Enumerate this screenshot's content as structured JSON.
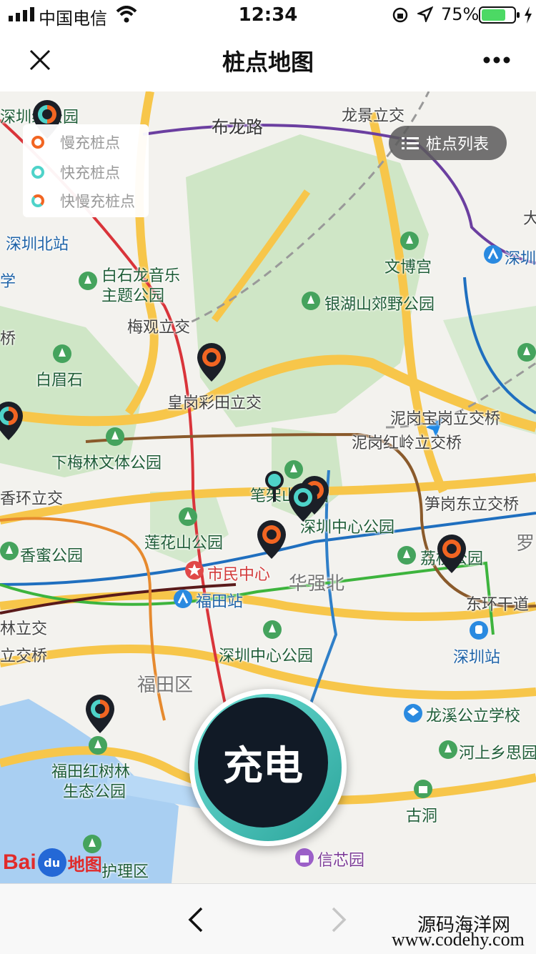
{
  "status_bar": {
    "carrier": "中国电信",
    "time": "12:34",
    "battery_percent": "75%",
    "battery_level": 0.75,
    "icons": [
      "signal-icon",
      "wifi-icon",
      "rotation-lock-icon",
      "location-arrow-icon",
      "battery-icon",
      "charging-bolt-icon"
    ]
  },
  "navbar": {
    "title": "桩点地图",
    "close_icon": "close-icon",
    "more_icon": "more-dots-icon"
  },
  "legend": {
    "items": [
      {
        "label": "慢充桩点",
        "color": "#f26522"
      },
      {
        "label": "快充桩点",
        "color": "#4ed3c9"
      },
      {
        "label": "快慢充桩点",
        "color": "mixed"
      }
    ]
  },
  "list_button": {
    "label": "桩点列表",
    "icon": "list-icon"
  },
  "map": {
    "labels": {
      "l1": "深圳线公园",
      "l2": "布龙路",
      "l3": "龙景立交",
      "l4": "深圳北站",
      "l5": "白石龙音乐",
      "l6": "主题公园",
      "l7": "文博宫",
      "l8": "银湖山郊野公园",
      "l9": "梅观立交",
      "l10": "白眉石",
      "l11": "皇岗彩田立交",
      "l12": "泥岗宝岗立交桥",
      "l13": "泥岗红岭立交桥",
      "l14": "下梅林文体公园",
      "l15": "香环立交",
      "l16": "笋岗东立交桥",
      "l17": "深圳中心公园",
      "l18": "莲花山公园",
      "l19": "香蜜公园",
      "l20": "市民中心",
      "l21": "华强北",
      "l22": "荔枝公园",
      "l23": "福田站",
      "l24": "东环干道",
      "l25": "林立交",
      "l26": "立交桥",
      "l27": "深圳中心公园",
      "l28": "深圳站",
      "l29": "福田区",
      "l30": "龙溪公立学校",
      "l31": "福田红树林",
      "l32": "生态公园",
      "l33": "河上乡思园",
      "l34": "古洞",
      "l35": "信芯园",
      "l36": "护理区",
      "l37": "罗",
      "l38": "深圳",
      "l39": "大",
      "l40": "学",
      "l41": "桥",
      "l42": "笔架山公园"
    }
  },
  "charge_button": {
    "label": "充电"
  },
  "baidu_logo": {
    "part1": "Bai",
    "part2": "du",
    "part3": "地图"
  },
  "bottom_nav": {
    "back_icon": "chevron-left-icon",
    "forward_icon": "chevron-right-icon"
  },
  "watermark": {
    "line1": "源码海洋网",
    "line2": "www.codehy.com"
  }
}
